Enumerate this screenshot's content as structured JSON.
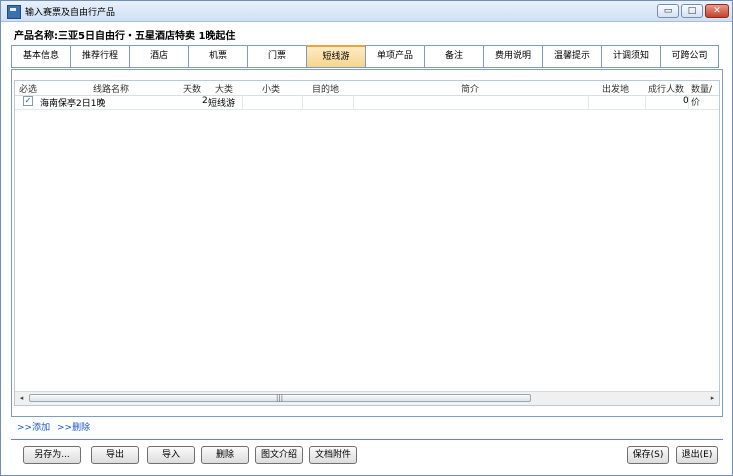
{
  "window": {
    "title": "输入赛票及自由行产品",
    "controls": {
      "minimize": "▭",
      "maximize": "□",
      "close": "✕"
    }
  },
  "product_name": "产品名称:三亚5日自由行・五星酒店特卖 1晚起住",
  "tabs": [
    "基本信息",
    "推荐行程",
    "酒店",
    "机票",
    "门票",
    "短线游",
    "单项产品",
    "备注",
    "费用说明",
    "温馨提示",
    "计调须知",
    "可跨公司"
  ],
  "active_tab": "短线游",
  "grid": {
    "headers": [
      "必选",
      "线路名称",
      "天数",
      "大类",
      "小类",
      "目的地",
      "简介",
      "出发地",
      "成行人数",
      "数量/价"
    ],
    "rows": [
      {
        "checked": "✓",
        "name": "海南保亭2日1晚",
        "days": "2",
        "category": "短线游",
        "subcategory": "",
        "destination": "",
        "intro": "",
        "departure": "",
        "min_people": "0",
        "qty": ""
      }
    ],
    "scroll": {
      "left": "◂",
      "right": "▸",
      "grip": "|||"
    }
  },
  "links": {
    "add": ">>添加",
    "delete": ">>删除"
  },
  "buttons": {
    "save_as": "另存为...",
    "export": "导出",
    "import": "导入",
    "delete": "删除",
    "image_intro": "图文介绍",
    "attachment": "文档附件",
    "save": "保存(S)",
    "exit": "退出(E)"
  }
}
